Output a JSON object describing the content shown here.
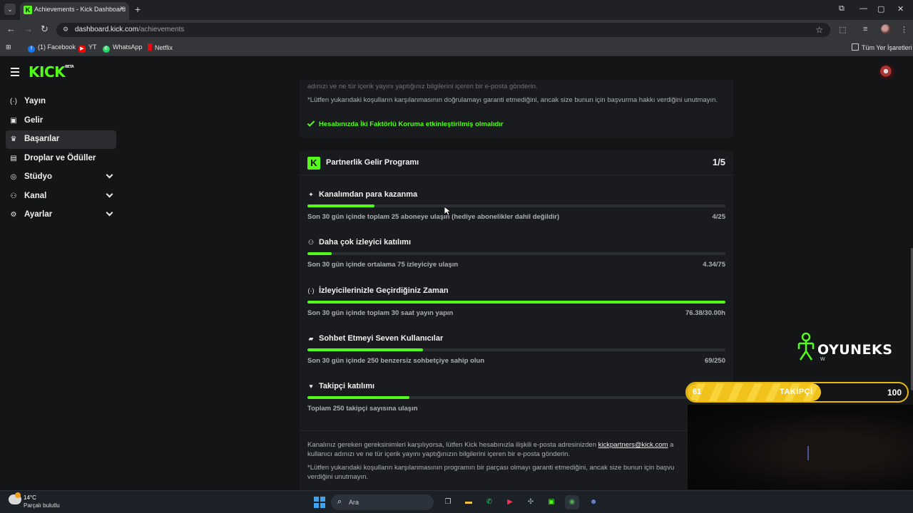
{
  "browser": {
    "tab_title": "Achievements - Kick Dashboard",
    "tab_favicon": "K",
    "url_host": "dashboard.kick.com",
    "url_path": "/achievements",
    "bookmarks": [
      "(1) Facebook",
      "YT",
      "WhatsApp",
      "Netflix"
    ],
    "all_bookmarks": "Tüm Yer İşaretleri"
  },
  "header": {
    "logo": "KICK",
    "logo_badge": "BETA"
  },
  "sidebar": {
    "items": [
      {
        "label": "Yayın",
        "icon": "broadcast-icon"
      },
      {
        "label": "Gelir",
        "icon": "revenue-icon"
      },
      {
        "label": "Başarılar",
        "icon": "trophy-icon"
      },
      {
        "label": "Droplar ve Ödüller",
        "icon": "gift-icon"
      },
      {
        "label": "Stüdyo",
        "icon": "studio-icon"
      },
      {
        "label": "Kanal",
        "icon": "channel-icon"
      },
      {
        "label": "Ayarlar",
        "icon": "gear-icon"
      }
    ]
  },
  "top_card": {
    "line1": "adınızı ve ne tür içerik yayını yaptığınız bilgilerini içeren bir e-posta gönderin.",
    "disclaimer": "*Lütfen yukarıdaki koşulların karşılanmasının doğrulamayı garanti etmediğini, ancak size bunun için başvurma hakkı verdiğini unutmayın.",
    "check": "Hesabınızda İki Faktörlü Koruma etkinleştirilmiş olmalıdır"
  },
  "partner_card": {
    "badge": "K",
    "title": "Partnerlik Gelir Programı",
    "count": "1/5",
    "requirements": [
      {
        "title": "Kanalımdan para kazanma",
        "icon": "sparkle-icon",
        "desc": "Son 30 gün içinde toplam 25 aboneye ulaşın (hediye abonelikler dahil değildir)",
        "value": "4/25",
        "progress": 0.16
      },
      {
        "title": "Daha çok izleyici katılımı",
        "icon": "viewers-icon",
        "desc": "Son 30 gün içinde ortalama 75 izleyiciye ulaşın",
        "value": "4.34/75",
        "progress": 0.058
      },
      {
        "title": "İzleyicilerinizle Geçirdiğiniz Zaman",
        "icon": "broadcast-icon",
        "desc": "Son 30 gün içinde toplam 30 saat yayın yapın",
        "value": "76.38/30.00h",
        "progress": 1.0
      },
      {
        "title": "Sohbet Etmeyi Seven Kullanıcılar",
        "icon": "chat-icon",
        "desc": "Son 30 gün içinde 250 benzersiz sohbetçiye sahip olun",
        "value": "69/250",
        "progress": 0.276
      },
      {
        "title": "Takipçi katılımı",
        "icon": "heart-icon",
        "desc": "Toplam 250 takipçi sayısına ulaşın",
        "value": "",
        "progress": 0.244
      }
    ],
    "footer_text_a": "Kanalınız gereken gereksinimleri karşılıyorsa, lütfen Kick hesabınızla ilişkili e-posta adresinizden",
    "footer_email": "kickpartners@kick.com",
    "footer_text_b": "a",
    "footer_line2": "kullanıcı adınızı ve ne tür içerik yayını yaptığınızın bilgilerini içeren bir e-posta gönderin.",
    "footer_disclaimer": "*Lütfen yukarıdaki koşulların karşılanmasının programın bir parçası olmayı garanti etmediğini, ancak size bunun için başvu",
    "footer_disclaimer2": "verdiğini unutmayın."
  },
  "overlay": {
    "brand": "OYUNEKS",
    "brand_sub": "W",
    "follow_current": "61",
    "follow_label": "TAKİPÇİ",
    "follow_goal": "100",
    "follow_progress": 0.61
  },
  "taskbar": {
    "temp": "14°C",
    "weather": "Parçalı bulutlu",
    "search_placeholder": "Ara"
  }
}
